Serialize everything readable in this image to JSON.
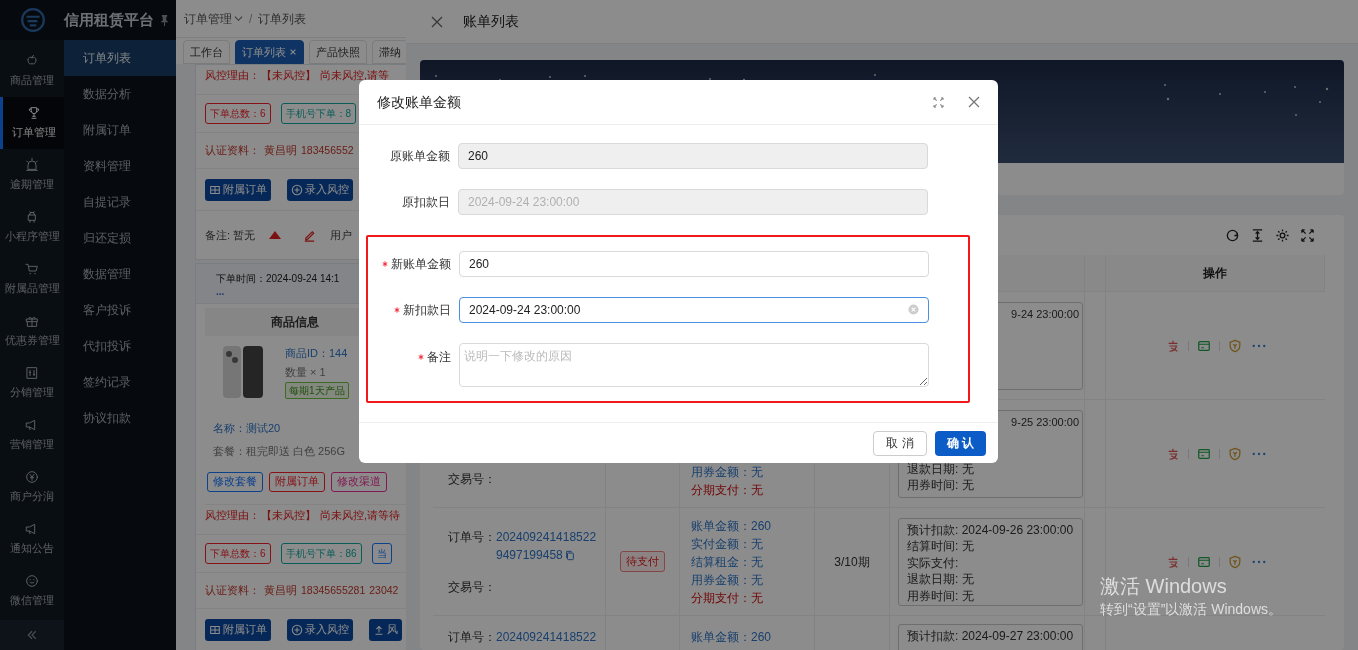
{
  "sidebar": {
    "title": "信用租赁平台",
    "rail": [
      {
        "label": "商品管理",
        "selected": false
      },
      {
        "label": "订单管理",
        "selected": true
      },
      {
        "label": "逾期管理",
        "selected": false
      },
      {
        "label": "小程序管理",
        "selected": false
      },
      {
        "label": "附属品管理",
        "selected": false
      },
      {
        "label": "优惠券管理",
        "selected": false
      },
      {
        "label": "分销管理",
        "selected": false
      },
      {
        "label": "营销管理",
        "selected": false
      },
      {
        "label": "商户分润",
        "selected": false
      },
      {
        "label": "通知公告",
        "selected": false
      },
      {
        "label": "微信管理",
        "selected": false
      }
    ],
    "submenu": [
      {
        "label": "订单列表",
        "selected": true
      },
      {
        "label": "数据分析",
        "selected": false
      },
      {
        "label": "附属订单",
        "selected": false
      },
      {
        "label": "资料管理",
        "selected": false
      },
      {
        "label": "自提记录",
        "selected": false
      },
      {
        "label": "归还定损",
        "selected": false
      },
      {
        "label": "数据管理",
        "selected": false
      },
      {
        "label": "客户投诉",
        "selected": false
      },
      {
        "label": "代扣投诉",
        "selected": false
      },
      {
        "label": "签约记录",
        "selected": false
      },
      {
        "label": "协议扣款",
        "selected": false
      }
    ]
  },
  "breadcrumb": {
    "items": [
      "订单管理",
      "订单列表"
    ],
    "separator": "/"
  },
  "tabs": [
    {
      "label": "工作台",
      "selected": false
    },
    {
      "label": "订单列表",
      "selected": true
    },
    {
      "label": "产品快照",
      "selected": false
    },
    {
      "label": "滞纳",
      "selected": false
    }
  ],
  "cards": [
    {
      "blocks": [
        {
          "kind": "risk",
          "label": "风控理由：",
          "tag": "【未风控】",
          "text": "尚未风控,请等"
        },
        {
          "kind": "stats",
          "items": [
            {
              "text": "下单总数：6",
              "kind": "danger"
            },
            {
              "text": "手机号下单：8",
              "kind": "success"
            }
          ]
        },
        {
          "kind": "auth",
          "label": "认证资料：",
          "values": [
            "黄昌明",
            "183456552"
          ]
        },
        {
          "kind": "actions",
          "buttons": [
            {
              "label": "附属订单",
              "kind": "grid"
            },
            {
              "label": "录入风控",
              "kind": "plus"
            }
          ]
        },
        {
          "kind": "remark",
          "text": "备注: 暂无",
          "note": "用户"
        }
      ]
    },
    {
      "blocks": [
        {
          "kind": "order_head",
          "time": "下单时间：2024-09-24 14:1",
          "more": "..."
        },
        {
          "kind": "product",
          "header": "商品信息",
          "id": "商品ID：144",
          "qty": "数量 × 1",
          "tag": "每期1天产品",
          "name": "名称：测试20",
          "package": "套餐：租完即送 白色 256G",
          "tags": [
            {
              "text": "修改套餐",
              "kind": "primary"
            },
            {
              "text": "附属订单",
              "kind": "danger"
            },
            {
              "text": "修改渠道",
              "kind": "magenta"
            }
          ]
        },
        {
          "kind": "risk",
          "label": "风控理由：",
          "tag": "【未风控】",
          "text": "尚未风控,请等待"
        },
        {
          "kind": "stats",
          "items": [
            {
              "text": "下单总数：6",
              "kind": "danger"
            },
            {
              "text": "手机号下单：86",
              "kind": "success"
            },
            {
              "text": "当",
              "kind": "primary"
            }
          ]
        },
        {
          "kind": "auth",
          "label": "认证资料：",
          "values": [
            "黄昌明",
            "18345655281",
            "23042"
          ]
        },
        {
          "kind": "actions",
          "buttons": [
            {
              "label": "附属订单",
              "kind": "grid"
            },
            {
              "label": "录入风控",
              "kind": "plus"
            },
            {
              "label": "风",
              "kind": "upload"
            }
          ]
        }
      ]
    }
  ],
  "drawer": {
    "title": "账单列表",
    "table": {
      "action_header": "操作",
      "rows": [
        {
          "schedule_tail": "9-24 23:00:00"
        },
        {
          "trade_label": "交易号：",
          "amount_lines": [
            {
              "text": "用券金额：无",
              "kind": "normal"
            },
            {
              "text": "分期支付：无",
              "kind": "alert"
            }
          ],
          "schedule_tail": "9-25 23:00:00",
          "schedule": [
            "退款日期: 无",
            "用券时间: 无"
          ]
        },
        {
          "order_label": "订单号：",
          "order_no": "2024092414185229497199458",
          "trade_label": "交易号：",
          "status": "待支付",
          "amount_lines": [
            {
              "text": "账单金额：260",
              "kind": "normal"
            },
            {
              "text": "实付金额：无",
              "kind": "normal"
            },
            {
              "text": "结算租金：无",
              "kind": "normal"
            },
            {
              "text": "用券金额：无",
              "kind": "normal"
            },
            {
              "text": "分期支付：无",
              "kind": "alert"
            }
          ],
          "period": "3/10期",
          "schedule": [
            "预计扣款: 2024-09-26 23:00:00",
            "结算时间: 无",
            "实际支付:",
            "退款日期: 无",
            "用券时间: 无"
          ]
        },
        {
          "order_label": "订单号：",
          "order_no": "202409241418522",
          "amount_lines": [
            {
              "text": "账单金额：260",
              "kind": "normal"
            }
          ],
          "schedule": [
            "预计扣款: 2024-09-27 23:00:00"
          ]
        }
      ]
    }
  },
  "modal": {
    "title": "修改账单金额",
    "fields": [
      {
        "label": "原账单金额",
        "value": "260",
        "required": false,
        "disabled": true,
        "focused": false
      },
      {
        "label": "原扣款日",
        "value": "2024-09-24 23:00:00",
        "required": false,
        "disabled": true,
        "focused": false
      }
    ],
    "highlighted_fields": [
      {
        "label": "新账单金额",
        "value": "260",
        "kind": "input",
        "required": true,
        "disabled": false,
        "focused": false
      },
      {
        "label": "新扣款日",
        "value": "2024-09-24 23:00:00",
        "kind": "input",
        "required": true,
        "disabled": false,
        "focused": true
      },
      {
        "label": "备注",
        "placeholder": "说明一下修改的原因",
        "kind": "textarea",
        "required": true,
        "disabled": false,
        "focused": false
      }
    ],
    "buttons": [
      {
        "label": "取 消",
        "primary": false
      },
      {
        "label": "确 认",
        "primary": true
      }
    ]
  },
  "windows_notice": {
    "title": "激活 Windows",
    "text": "转到“设置”以激活 Windows。"
  }
}
